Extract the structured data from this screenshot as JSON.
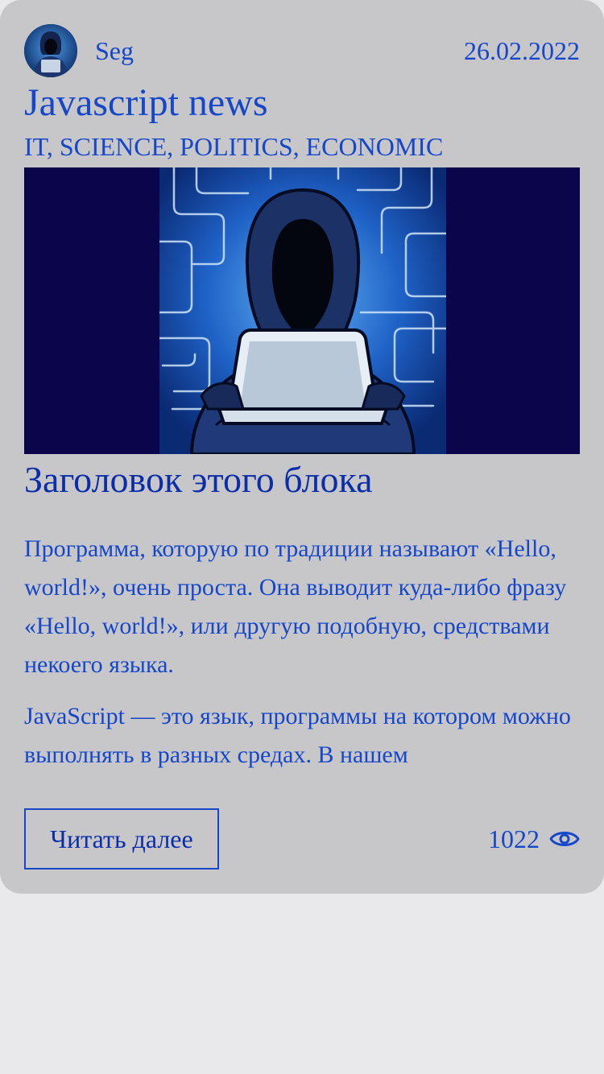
{
  "post": {
    "author": "Seg",
    "date": "26.02.2022",
    "title": "Javascript news",
    "tags": "IT, SCIENCE, POLITICS, ECONOMIC",
    "image_icon": "hooded-hacker-image",
    "block_title": "Заголовок этого блока",
    "paragraphs": [
      "Программа, которую по традиции называют «Hello, world!», очень проста. Она выводит куда-либо фразу «Hello, world!», или другую подобную, средствами некоего языка.",
      "JavaScript — это язык, программы на котором можно выполнять в разных средах. В нашем"
    ],
    "read_more_label": "Читать далее",
    "views": "1022",
    "views_icon": "eye-icon"
  },
  "colors": {
    "card_background": "#c7c7ca",
    "page_background": "#e9e9ec",
    "accent_blue": "#1747c9",
    "image_background": "#0b064b"
  }
}
